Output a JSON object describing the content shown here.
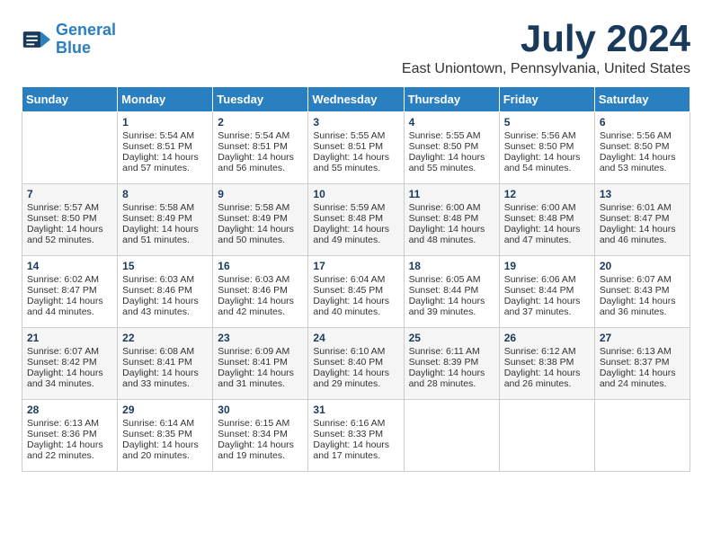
{
  "header": {
    "logo_line1": "General",
    "logo_line2": "Blue",
    "month_title": "July 2024",
    "subtitle": "East Uniontown, Pennsylvania, United States"
  },
  "days_of_week": [
    "Sunday",
    "Monday",
    "Tuesday",
    "Wednesday",
    "Thursday",
    "Friday",
    "Saturday"
  ],
  "weeks": [
    [
      {
        "day": "",
        "content": ""
      },
      {
        "day": "1",
        "content": "Sunrise: 5:54 AM\nSunset: 8:51 PM\nDaylight: 14 hours\nand 57 minutes."
      },
      {
        "day": "2",
        "content": "Sunrise: 5:54 AM\nSunset: 8:51 PM\nDaylight: 14 hours\nand 56 minutes."
      },
      {
        "day": "3",
        "content": "Sunrise: 5:55 AM\nSunset: 8:51 PM\nDaylight: 14 hours\nand 55 minutes."
      },
      {
        "day": "4",
        "content": "Sunrise: 5:55 AM\nSunset: 8:50 PM\nDaylight: 14 hours\nand 55 minutes."
      },
      {
        "day": "5",
        "content": "Sunrise: 5:56 AM\nSunset: 8:50 PM\nDaylight: 14 hours\nand 54 minutes."
      },
      {
        "day": "6",
        "content": "Sunrise: 5:56 AM\nSunset: 8:50 PM\nDaylight: 14 hours\nand 53 minutes."
      }
    ],
    [
      {
        "day": "7",
        "content": "Sunrise: 5:57 AM\nSunset: 8:50 PM\nDaylight: 14 hours\nand 52 minutes."
      },
      {
        "day": "8",
        "content": "Sunrise: 5:58 AM\nSunset: 8:49 PM\nDaylight: 14 hours\nand 51 minutes."
      },
      {
        "day": "9",
        "content": "Sunrise: 5:58 AM\nSunset: 8:49 PM\nDaylight: 14 hours\nand 50 minutes."
      },
      {
        "day": "10",
        "content": "Sunrise: 5:59 AM\nSunset: 8:48 PM\nDaylight: 14 hours\nand 49 minutes."
      },
      {
        "day": "11",
        "content": "Sunrise: 6:00 AM\nSunset: 8:48 PM\nDaylight: 14 hours\nand 48 minutes."
      },
      {
        "day": "12",
        "content": "Sunrise: 6:00 AM\nSunset: 8:48 PM\nDaylight: 14 hours\nand 47 minutes."
      },
      {
        "day": "13",
        "content": "Sunrise: 6:01 AM\nSunset: 8:47 PM\nDaylight: 14 hours\nand 46 minutes."
      }
    ],
    [
      {
        "day": "14",
        "content": "Sunrise: 6:02 AM\nSunset: 8:47 PM\nDaylight: 14 hours\nand 44 minutes."
      },
      {
        "day": "15",
        "content": "Sunrise: 6:03 AM\nSunset: 8:46 PM\nDaylight: 14 hours\nand 43 minutes."
      },
      {
        "day": "16",
        "content": "Sunrise: 6:03 AM\nSunset: 8:46 PM\nDaylight: 14 hours\nand 42 minutes."
      },
      {
        "day": "17",
        "content": "Sunrise: 6:04 AM\nSunset: 8:45 PM\nDaylight: 14 hours\nand 40 minutes."
      },
      {
        "day": "18",
        "content": "Sunrise: 6:05 AM\nSunset: 8:44 PM\nDaylight: 14 hours\nand 39 minutes."
      },
      {
        "day": "19",
        "content": "Sunrise: 6:06 AM\nSunset: 8:44 PM\nDaylight: 14 hours\nand 37 minutes."
      },
      {
        "day": "20",
        "content": "Sunrise: 6:07 AM\nSunset: 8:43 PM\nDaylight: 14 hours\nand 36 minutes."
      }
    ],
    [
      {
        "day": "21",
        "content": "Sunrise: 6:07 AM\nSunset: 8:42 PM\nDaylight: 14 hours\nand 34 minutes."
      },
      {
        "day": "22",
        "content": "Sunrise: 6:08 AM\nSunset: 8:41 PM\nDaylight: 14 hours\nand 33 minutes."
      },
      {
        "day": "23",
        "content": "Sunrise: 6:09 AM\nSunset: 8:41 PM\nDaylight: 14 hours\nand 31 minutes."
      },
      {
        "day": "24",
        "content": "Sunrise: 6:10 AM\nSunset: 8:40 PM\nDaylight: 14 hours\nand 29 minutes."
      },
      {
        "day": "25",
        "content": "Sunrise: 6:11 AM\nSunset: 8:39 PM\nDaylight: 14 hours\nand 28 minutes."
      },
      {
        "day": "26",
        "content": "Sunrise: 6:12 AM\nSunset: 8:38 PM\nDaylight: 14 hours\nand 26 minutes."
      },
      {
        "day": "27",
        "content": "Sunrise: 6:13 AM\nSunset: 8:37 PM\nDaylight: 14 hours\nand 24 minutes."
      }
    ],
    [
      {
        "day": "28",
        "content": "Sunrise: 6:13 AM\nSunset: 8:36 PM\nDaylight: 14 hours\nand 22 minutes."
      },
      {
        "day": "29",
        "content": "Sunrise: 6:14 AM\nSunset: 8:35 PM\nDaylight: 14 hours\nand 20 minutes."
      },
      {
        "day": "30",
        "content": "Sunrise: 6:15 AM\nSunset: 8:34 PM\nDaylight: 14 hours\nand 19 minutes."
      },
      {
        "day": "31",
        "content": "Sunrise: 6:16 AM\nSunset: 8:33 PM\nDaylight: 14 hours\nand 17 minutes."
      },
      {
        "day": "",
        "content": ""
      },
      {
        "day": "",
        "content": ""
      },
      {
        "day": "",
        "content": ""
      }
    ]
  ]
}
